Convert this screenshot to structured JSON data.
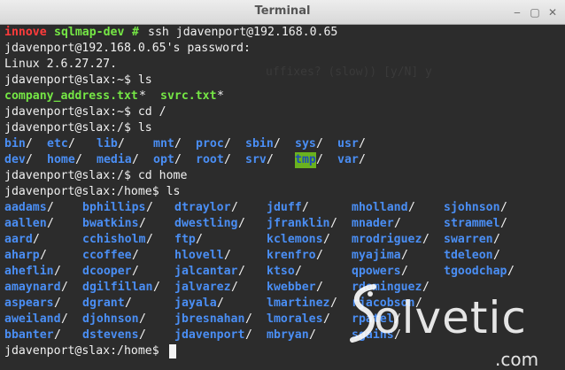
{
  "window": {
    "title": "Terminal",
    "minimize_glyph": "‒",
    "maximize_glyph": "▢",
    "close_glyph": "✕"
  },
  "terminal": {
    "ghost_text": "uffixes? (slow)) [y/N] y",
    "line0": {
      "host": "innove",
      "dir": "sqlmap-dev",
      "hash": "#",
      "cmd": "ssh jdavenport@192.168.0.65"
    },
    "line1": "jdavenport@192.168.0.65's password:",
    "line2": "Linux 2.6.27.27.",
    "line3": "jdavenport@slax:~$ ls",
    "line4": {
      "file1": "company_address.txt",
      "mark1": "*",
      "file2": "svrc.txt",
      "mark2": "*"
    },
    "line5": "jdavenport@slax:~$ cd /",
    "line6": "jdavenport@slax:/$ ls",
    "root_row1": [
      "bin",
      "etc",
      "lib",
      "mnt",
      "proc",
      "sbin",
      "sys",
      "usr"
    ],
    "root_row2": [
      "dev",
      "home",
      "media",
      "opt",
      "root",
      "srv",
      "tmp",
      "var"
    ],
    "slash": "/",
    "line9": "jdavenport@slax:/$ cd home",
    "line10": "jdavenport@slax:/home$ ls",
    "home_rows": [
      [
        "aadams",
        "bphillips",
        "dtraylor",
        "jduff",
        "mholland",
        "sjohnson"
      ],
      [
        "aallen",
        "bwatkins",
        "dwestling",
        "jfranklin",
        "mnader",
        "strammel"
      ],
      [
        "aard",
        "cchisholm",
        "ftp",
        "kclemons",
        "mrodriguez",
        "swarren"
      ],
      [
        "aharp",
        "ccoffee",
        "hlovell",
        "krenfro",
        "myajima",
        "tdeleon"
      ],
      [
        "aheflin",
        "dcooper",
        "jalcantar",
        "ktso",
        "qpowers",
        "tgoodchap"
      ],
      [
        "amaynard",
        "dgilfillan",
        "jalvarez",
        "kwebber",
        "rdominguez"
      ],
      [
        "aspears",
        "dgrant",
        "jayala",
        "lmartinez",
        "rjacobson"
      ],
      [
        "aweiland",
        "djohnson",
        "jbresnahan",
        "lmorales",
        "rpatel"
      ],
      [
        "bbanter",
        "dstevens",
        "jdavenport",
        "mbryan",
        "sgains"
      ]
    ],
    "prompt_final": "jdavenport@slax:/home$"
  },
  "watermark": {
    "brand": "olvetic",
    "domain": ".com"
  },
  "colors": {
    "background": "#2c2c2c",
    "prompt_red": "#ff3b3b",
    "prompt_green": "#75e645",
    "directory_blue": "#4a8ef4",
    "highlight_green": "#6ab21f",
    "text": "#f0f0f0"
  }
}
